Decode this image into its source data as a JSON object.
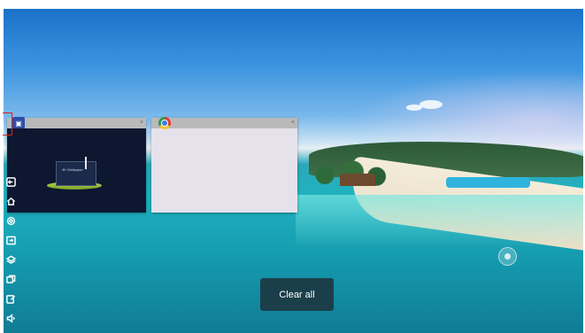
{
  "wallpaper": {
    "name": "tropical-island-wallpaper"
  },
  "recent_tasks": [
    {
      "id": "task-1",
      "icon": "app-icon-1",
      "close_glyph": "×",
      "preview_text": "4K Wallpaper"
    },
    {
      "id": "task-2",
      "icon": "chrome-icon",
      "close_glyph": "×"
    }
  ],
  "sidebar": {
    "items": [
      {
        "icon": "exit-icon"
      },
      {
        "icon": "home-icon"
      },
      {
        "icon": "settings-icon"
      },
      {
        "icon": "input-source-icon"
      },
      {
        "icon": "layers-icon"
      },
      {
        "icon": "windows-icon"
      },
      {
        "icon": "annotate-icon"
      },
      {
        "icon": "volume-icon"
      }
    ]
  },
  "clear_all": {
    "label": "Clear all"
  },
  "floating_button": {
    "icon": "floating-ball-icon"
  }
}
